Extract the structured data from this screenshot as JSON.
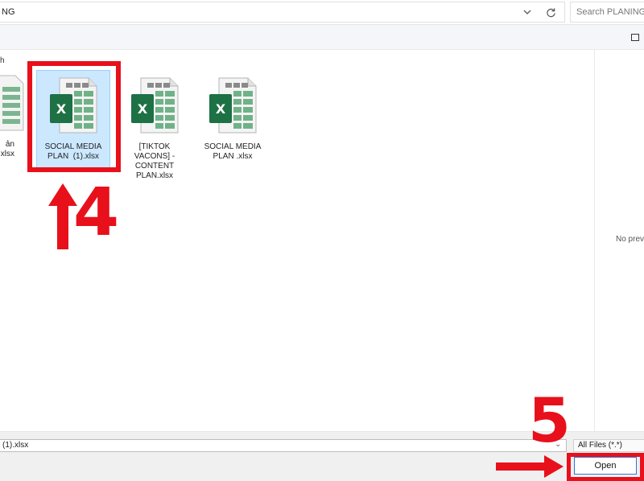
{
  "address_bar": {
    "path": "NG",
    "dropdown_icon": "chevron-down-icon",
    "refresh_icon": "refresh-icon"
  },
  "search": {
    "placeholder": "Search PLANING"
  },
  "nav": {
    "partial_label": "h"
  },
  "files": [
    {
      "name": "ản\n.xlsx",
      "selected": false
    },
    {
      "name": "SOCIAL MEDIA\nPLAN  (1).xlsx",
      "selected": true
    },
    {
      "name": "[TIKTOK\nVACONS] -\nCONTENT\nPLAN.xlsx",
      "selected": false
    },
    {
      "name": "SOCIAL MEDIA\nPLAN .xlsx",
      "selected": false
    }
  ],
  "preview": {
    "text": "No prev"
  },
  "footer": {
    "filename_value": "(1).xlsx",
    "file_type_filter": "All Files (*.*)",
    "open_label": "Open"
  },
  "annotations": {
    "step_a": "4",
    "step_b": "5"
  },
  "colors": {
    "highlight": "#e8101b",
    "selection": "#cce8ff",
    "excel_green": "#1e7145",
    "accent_blue": "#2b78d6"
  }
}
